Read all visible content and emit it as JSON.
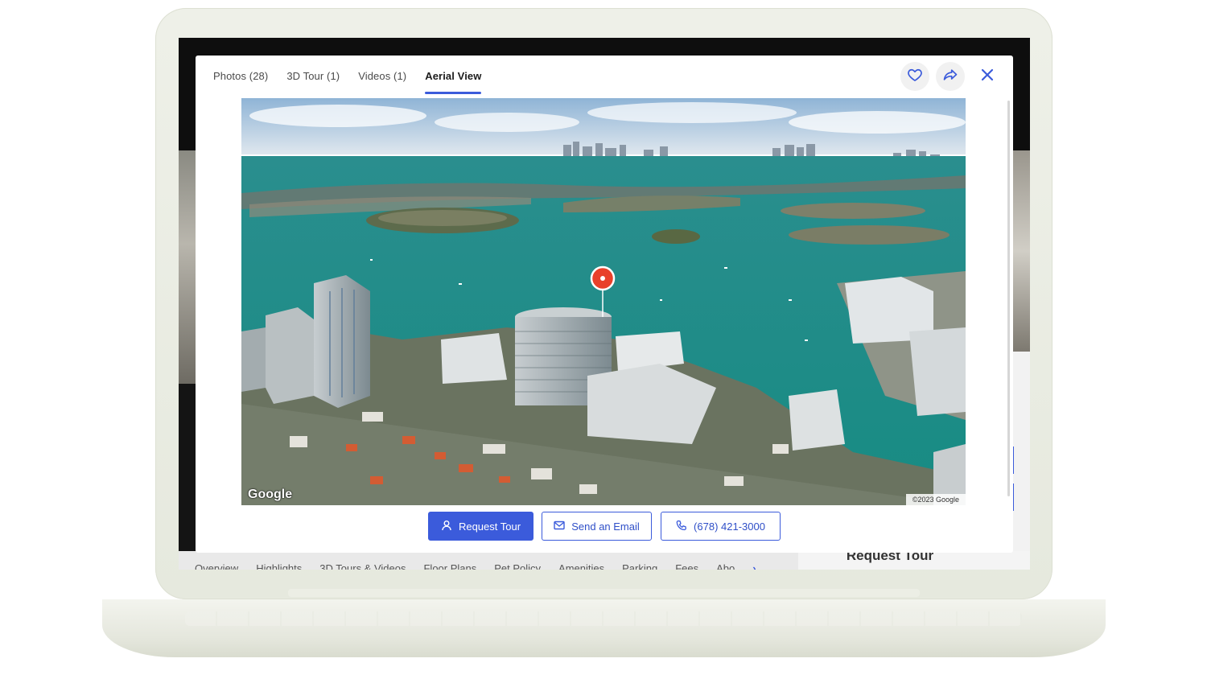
{
  "modal": {
    "tabs": [
      {
        "label": "Photos (28)",
        "active": false
      },
      {
        "label": "3D Tour (1)",
        "active": false
      },
      {
        "label": "Videos (1)",
        "active": false
      },
      {
        "label": "Aerial View",
        "active": true
      }
    ],
    "icons": {
      "favorite": "heart-icon",
      "share": "share-icon",
      "close": "close-icon"
    },
    "aerial": {
      "logo": "Google",
      "copyright": "©2023 Google"
    },
    "actions": {
      "request_tour": "Request Tour",
      "send_email": "Send an Email",
      "phone": "(678) 421-3000"
    }
  },
  "background": {
    "nav": [
      "Overview",
      "Highlights",
      "3D Tours & Videos",
      "Floor Plans",
      "Pet Policy",
      "Amenities",
      "Parking",
      "Fees",
      "Abo"
    ],
    "request_tour_heading": "Request Tour"
  },
  "colors": {
    "accent": "#3b5bdb",
    "marker": "#e8402a",
    "water": "#1f8f88"
  }
}
